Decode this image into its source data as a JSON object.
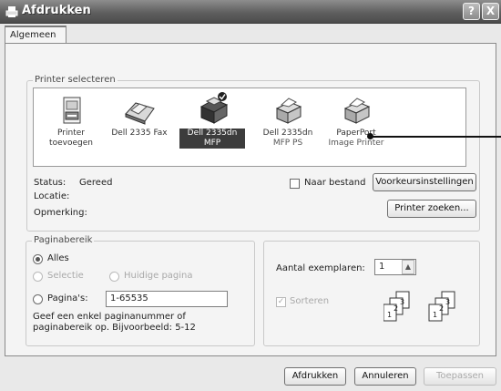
{
  "window": {
    "title": "Afdrukken",
    "help_glyph": "?",
    "close_glyph": "X"
  },
  "tabs": [
    {
      "label": "Algemeen"
    }
  ],
  "printer_select": {
    "legend": "Printer selecteren",
    "printers": [
      {
        "label_line1": "Printer",
        "label_line2": "toevoegen",
        "icon": "add-printer-icon"
      },
      {
        "label_line1": "Dell 2335 Fax",
        "label_line2": "",
        "icon": "fax-icon"
      },
      {
        "label_line1": "Dell 2335dn",
        "label_line2": "MFP",
        "icon": "printer-default-icon",
        "selected": true
      },
      {
        "label_line1": "Dell 2335dn",
        "label_line2": "MFP PS",
        "icon": "printer-icon"
      },
      {
        "label_line1": "PaperPort",
        "label_line2": "Image Printer",
        "icon": "printer-icon"
      }
    ],
    "status_label": "Status:",
    "status_value": "Gereed",
    "location_label": "Locatie:",
    "comment_label": "Opmerking:",
    "print_to_file_label": "Naar bestand",
    "preferences_button": "Voorkeursinstellingen",
    "find_printer_button": "Printer zoeken..."
  },
  "page_range": {
    "legend": "Paginabereik",
    "all_label": "Alles",
    "selection_label": "Selectie",
    "current_page_label": "Huidige pagina",
    "pages_label": "Pagina's:",
    "pages_value": "1-65535",
    "hint_line1": "Geef een enkel paginanummer of",
    "hint_line2": "paginabereik op. Bijvoorbeeld: 5-12"
  },
  "copies": {
    "label": "Aantal exemplaren:",
    "value": "1",
    "collate_label": "Sorteren"
  },
  "buttons": {
    "print": "Afdrukken",
    "cancel": "Annuleren",
    "apply": "Toepassen"
  }
}
